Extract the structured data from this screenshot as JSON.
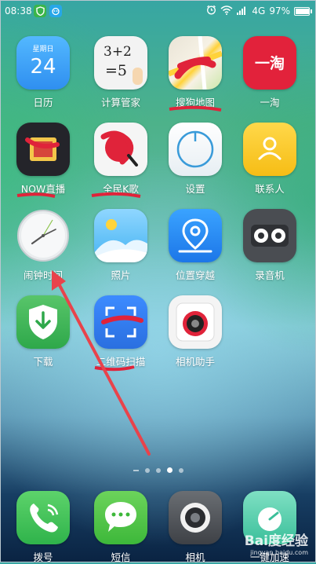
{
  "status_bar": {
    "time": "08:38",
    "network": "4G",
    "battery": "97%",
    "battery_level": 0.97,
    "left_icons": [
      "shield-app-icon",
      "app-notification-icon"
    ],
    "right_icons": [
      "alarm-icon",
      "wifi-icon",
      "signal-icon",
      "battery-icon"
    ]
  },
  "apps": [
    {
      "label": "日历",
      "icon": "calendar-icon",
      "icon_text_top": "星期日",
      "icon_text_main": "24"
    },
    {
      "label": "计算管家",
      "icon": "calculator-icon",
      "icon_text_top": "3+2",
      "icon_text_main": "=5"
    },
    {
      "label": "搜狗地图",
      "icon": "map-icon"
    },
    {
      "label": "一淘",
      "icon": "etao-icon",
      "icon_text_main": "一淘"
    },
    {
      "label": "NOW直播",
      "icon": "now-live-icon"
    },
    {
      "label": "全民K歌",
      "icon": "karaoke-icon"
    },
    {
      "label": "设置",
      "icon": "settings-icon"
    },
    {
      "label": "联系人",
      "icon": "contacts-icon"
    },
    {
      "label": "闹钟时间",
      "icon": "clock-icon"
    },
    {
      "label": "照片",
      "icon": "photos-icon"
    },
    {
      "label": "位置穿越",
      "icon": "location-icon"
    },
    {
      "label": "录音机",
      "icon": "recorder-icon"
    },
    {
      "label": "下载",
      "icon": "download-icon"
    },
    {
      "label": "二维码扫描",
      "icon": "scan-icon"
    },
    {
      "label": "相机助手",
      "icon": "camera-assistant-icon"
    }
  ],
  "dock": [
    {
      "label": "拨号",
      "icon": "phone-icon"
    },
    {
      "label": "短信",
      "icon": "messages-icon"
    },
    {
      "label": "相机",
      "icon": "camera-icon"
    },
    {
      "label": "一键加速",
      "icon": "boost-icon"
    }
  ],
  "page_indicator": {
    "pages": 4,
    "active_index": 2
  },
  "watermark": {
    "main": "Bai度经验",
    "sub": "jingyan.baidu.com"
  },
  "colors": {
    "annotation_arrow": "#e8434b",
    "redaction": "#e0233a"
  }
}
